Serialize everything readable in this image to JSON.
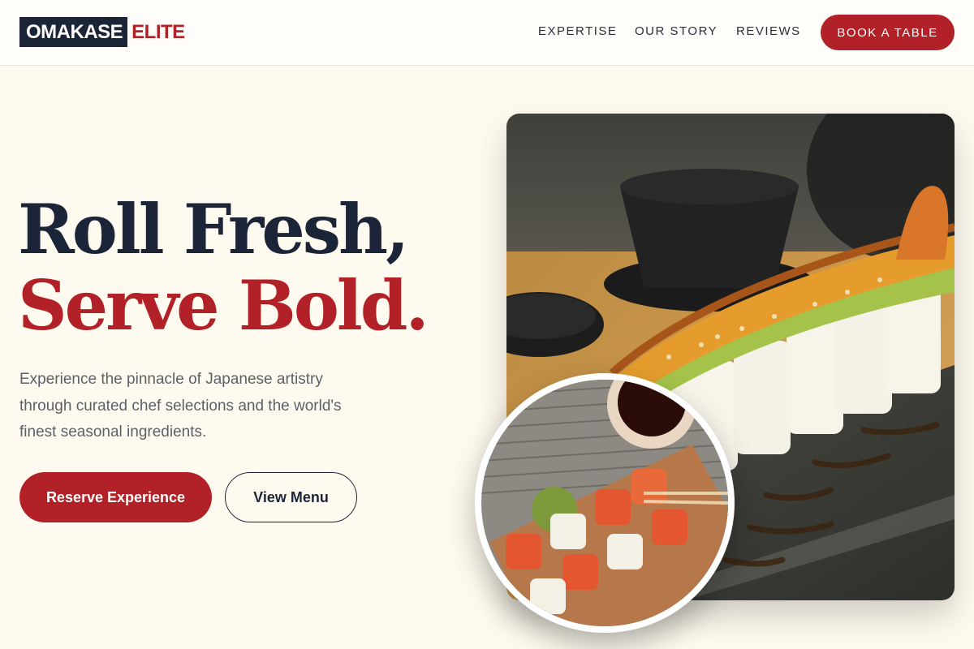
{
  "brand": {
    "name_main": "OMAKASE",
    "name_accent": "ELITE"
  },
  "nav": {
    "links": [
      "EXPERTISE",
      "OUR STORY",
      "REVIEWS"
    ],
    "cta": "BOOK A TABLE"
  },
  "hero": {
    "headline_line1": "Roll Fresh,",
    "headline_line2": "Serve Bold.",
    "description": "Experience the pinnacle of Japanese artistry through curated chef selections and the world's finest seasonal ingredients.",
    "primary_button": "Reserve Experience",
    "secondary_button": "View Menu"
  },
  "colors": {
    "navy": "#1c2538",
    "accent_red": "#b22127",
    "cream": "#fefaef"
  },
  "images": {
    "main": "sushi-roll-on-slate-photo",
    "inset": "salmon-sushi-on-wooden-board-photo"
  }
}
